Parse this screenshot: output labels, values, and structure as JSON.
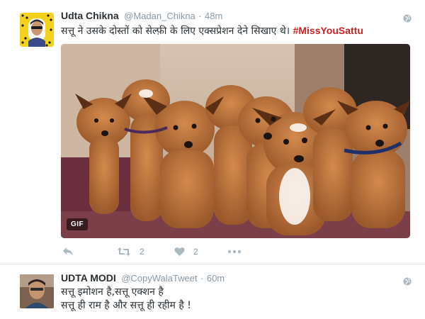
{
  "tweets": [
    {
      "name": "Udta Chikna",
      "handle": "@Madan_Chikna",
      "separator": "·",
      "time": "48m",
      "text": "सत्तू ने उसके दोस्तों को सेल्फ़ी के लिए एक्सप्रेशन देने सिखाए थे।",
      "hashtag": "#MissYouSattu",
      "media_badge": "GIF",
      "retweet_count": "2",
      "like_count": "2",
      "icons": [
        "reply-icon",
        "retweet-icon",
        "like-icon",
        "more-icon",
        "globe-icon"
      ]
    },
    {
      "name": "UDTA MODI",
      "handle": "@CopyWalaTweet",
      "separator": "·",
      "time": "60m",
      "text_line1": "सत्तू इमोशन है,सत्तू एक्शन है",
      "text_line2": "सत्तू ही राम है और सत्तू ही रहीम है !",
      "icons": [
        "globe-icon"
      ]
    }
  ],
  "colors": {
    "hashtag": "#cc2222",
    "meta": "#8899a6",
    "text": "#292f33",
    "avatar1_bg": "#f2d21a"
  }
}
